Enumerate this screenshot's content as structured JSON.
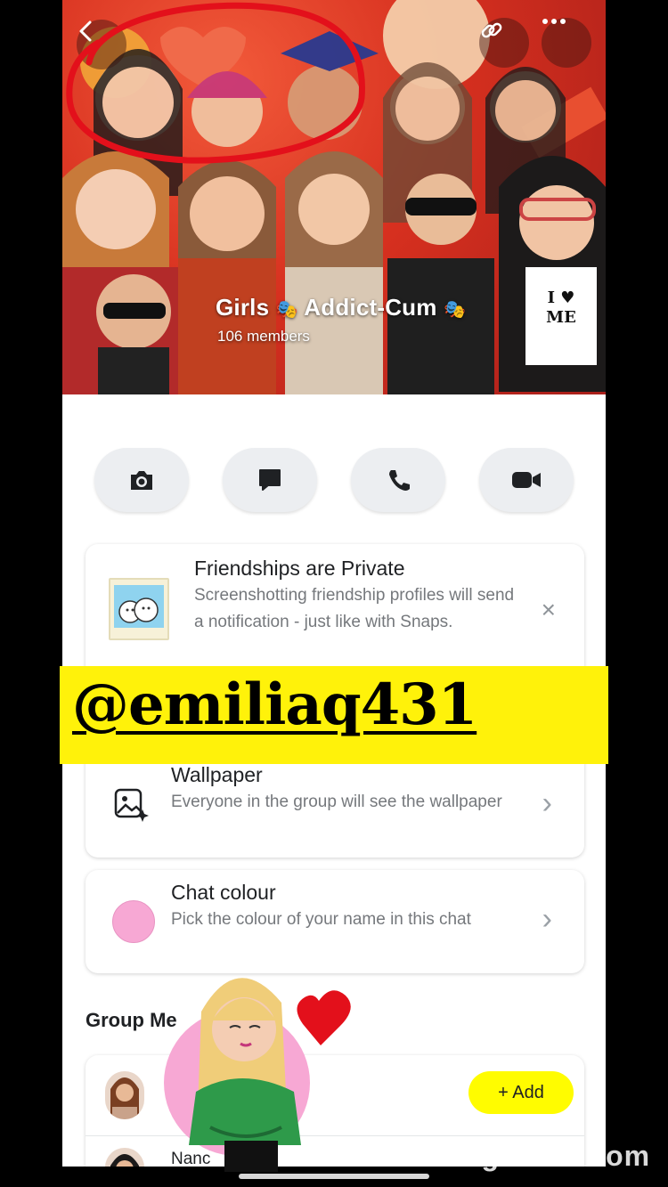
{
  "header": {
    "group_name": "Girls",
    "group_name_suffix": "Addict-Cum",
    "member_count": "106 members",
    "emoji": "🎭",
    "shirt_text_1": "I",
    "shirt_text_2": "ME"
  },
  "actions": [
    {
      "icon": "camera-icon"
    },
    {
      "icon": "chat-icon"
    },
    {
      "icon": "phone-icon"
    },
    {
      "icon": "video-icon"
    }
  ],
  "privacy_card": {
    "title": "Friendships are Private",
    "subtitle": "Screenshotting friendship profiles will send a notification - just like with Snaps.",
    "close": "×"
  },
  "overlay": {
    "handle": "@emiliaq431",
    "watermark": "ngFinds com"
  },
  "wallpaper_card": {
    "title": "Wallpaper",
    "subtitle": "Everyone in the group will see the wallpaper",
    "chevron": "›"
  },
  "chat_colour_card": {
    "title": "Chat colour",
    "subtitle": "Pick the colour of your name in this chat",
    "chevron": "›",
    "colour": "#f7a8d4"
  },
  "members": {
    "heading": "Group Me",
    "add_label": "+  Add",
    "first_member_name": "Nanc"
  },
  "colors": {
    "snap_yellow": "#fffc00",
    "highlight_red": "#e3101b",
    "banner_red": "#d7301f"
  }
}
